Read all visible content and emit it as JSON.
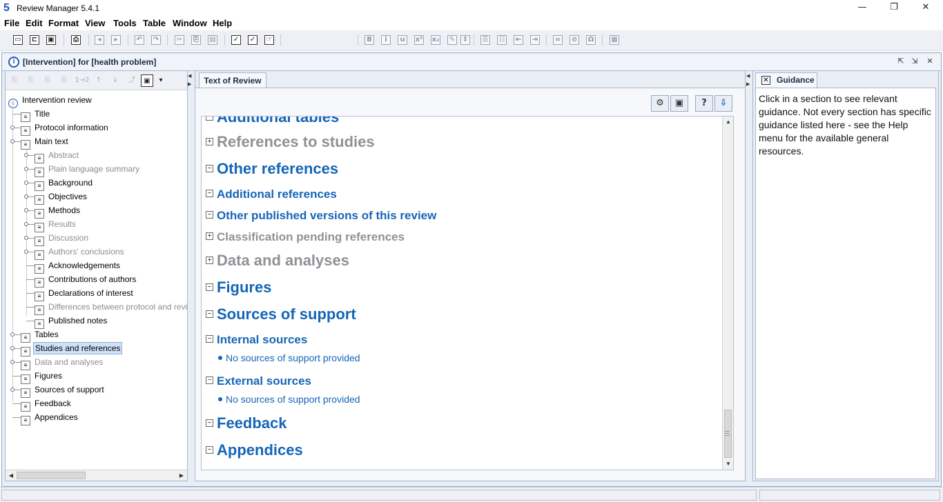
{
  "app": {
    "title": "Review Manager 5.4.1",
    "icon_glyph": "5"
  },
  "window_controls": {
    "minimize": "—",
    "maximize": "❐",
    "close": "✕"
  },
  "menu": [
    "File",
    "Edit",
    "Format",
    "View",
    "Tools",
    "Table",
    "Window",
    "Help"
  ],
  "toolbar": {
    "font_combo_value": "",
    "buttons": [
      "new",
      "open",
      "save",
      "print",
      "back",
      "forward",
      "undo",
      "redo",
      "cut",
      "copy",
      "paste",
      "spell-check",
      "spell-check-abc",
      "validate",
      "bold",
      "italic",
      "underline",
      "superscript",
      "subscript",
      "edit",
      "insert",
      "bullets",
      "numbering",
      "outdent",
      "indent",
      "link",
      "unlink",
      "symbol",
      "table"
    ]
  },
  "frame": {
    "title": "[Intervention] for [health problem]",
    "controls": [
      "⇱",
      "⇲",
      "✕"
    ]
  },
  "left_tools": [
    "⎘",
    "⎘",
    "⎘",
    "⎘",
    "1→2",
    "↑",
    "↓",
    "⤴",
    "▣",
    "▾"
  ],
  "tree": {
    "root": "Intervention review",
    "items": [
      {
        "label": "Title",
        "level": 1,
        "dim": false
      },
      {
        "label": "Protocol information",
        "level": 1,
        "dim": false
      },
      {
        "label": "Main text",
        "level": 1,
        "dim": false
      },
      {
        "label": "Abstract",
        "level": 2,
        "dim": true
      },
      {
        "label": "Plain language summary",
        "level": 2,
        "dim": true
      },
      {
        "label": "Background",
        "level": 2,
        "dim": false
      },
      {
        "label": "Objectives",
        "level": 2,
        "dim": false
      },
      {
        "label": "Methods",
        "level": 2,
        "dim": false
      },
      {
        "label": "Results",
        "level": 2,
        "dim": true
      },
      {
        "label": "Discussion",
        "level": 2,
        "dim": true
      },
      {
        "label": "Authors' conclusions",
        "level": 2,
        "dim": true
      },
      {
        "label": "Acknowledgements",
        "level": 2,
        "dim": false
      },
      {
        "label": "Contributions of authors",
        "level": 2,
        "dim": false
      },
      {
        "label": "Declarations of interest",
        "level": 2,
        "dim": false
      },
      {
        "label": "Differences between protocol and review",
        "level": 2,
        "dim": true
      },
      {
        "label": "Published notes",
        "level": 2,
        "dim": false
      },
      {
        "label": "Tables",
        "level": 1,
        "dim": false
      },
      {
        "label": "Studies and references",
        "level": 1,
        "dim": false,
        "selected": true
      },
      {
        "label": "Data and analyses",
        "level": 1,
        "dim": true
      },
      {
        "label": "Figures",
        "level": 1,
        "dim": false
      },
      {
        "label": "Sources of support",
        "level": 1,
        "dim": false
      },
      {
        "label": "Feedback",
        "level": 1,
        "dim": false
      },
      {
        "label": "Appendices",
        "level": 1,
        "dim": false
      }
    ]
  },
  "center": {
    "tab_label": "Text of Review",
    "tool_buttons": [
      "⚙",
      "▣",
      "?",
      "⇩"
    ],
    "sections": [
      {
        "text": "Additional tables",
        "size": "h1",
        "toggle": "⊟",
        "dim": false
      },
      {
        "text": "References to studies",
        "size": "h1",
        "toggle": "⊞",
        "dim": true
      },
      {
        "text": "Other references",
        "size": "h1",
        "toggle": "⊟",
        "dim": false
      },
      {
        "text": "Additional references",
        "size": "h2",
        "toggle": "⊟",
        "dim": false
      },
      {
        "text": "Other published versions of this review",
        "size": "h2",
        "toggle": "⊟",
        "dim": false
      },
      {
        "text": "Classification pending references",
        "size": "h2",
        "toggle": "⊞",
        "dim": true
      },
      {
        "text": "Data and analyses",
        "size": "h1",
        "toggle": "⊞",
        "dim": true
      },
      {
        "text": "Figures",
        "size": "h1",
        "toggle": "⊟",
        "dim": false
      },
      {
        "text": "Sources of support",
        "size": "h1",
        "toggle": "⊟",
        "dim": false
      },
      {
        "text": "Internal sources",
        "size": "h2",
        "toggle": "⊟",
        "dim": false
      },
      {
        "text": "No sources of support provided",
        "size": "bullet"
      },
      {
        "text": "External sources",
        "size": "h2",
        "toggle": "⊟",
        "dim": false
      },
      {
        "text": "No sources of support provided",
        "size": "bullet"
      },
      {
        "text": "Feedback",
        "size": "h1",
        "toggle": "⊟",
        "dim": false
      },
      {
        "text": "Appendices",
        "size": "h1",
        "toggle": "⊟",
        "dim": false
      }
    ]
  },
  "guidance": {
    "tab_label": "Guidance",
    "text": "Click in a section to see relevant guidance. Not every section has specific guidance listed here - see the Help menu for the available general resources."
  },
  "colors": {
    "heading": "#1565b8",
    "dim": "#8e9296"
  }
}
